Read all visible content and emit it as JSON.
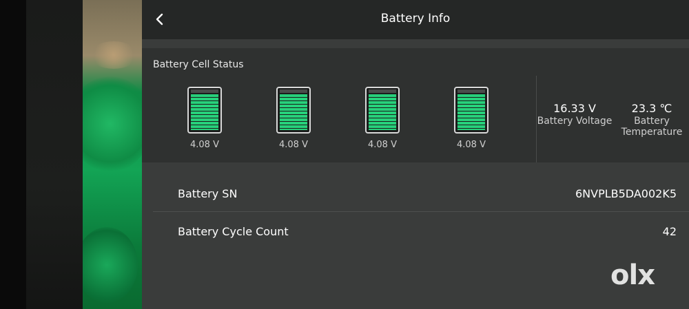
{
  "header": {
    "title": "Battery Info",
    "back_icon": "chevron-left-icon"
  },
  "cell_status": {
    "title": "Battery Cell Status",
    "cells": [
      {
        "voltage": "4.08 V",
        "charge_fraction": 1.0
      },
      {
        "voltage": "4.08 V",
        "charge_fraction": 1.0
      },
      {
        "voltage": "4.08 V",
        "charge_fraction": 1.0
      },
      {
        "voltage": "4.08 V",
        "charge_fraction": 1.0
      }
    ],
    "voltage": {
      "value": "16.33 V",
      "label": "Battery Voltage"
    },
    "temperature": {
      "value": "23.3 ℃",
      "label_line1": "Battery",
      "label_line2": "Temperature"
    }
  },
  "rows": [
    {
      "label": "Battery SN",
      "value": "6NVPLB5DA002K5"
    },
    {
      "label": "Battery Cycle Count",
      "value": "42"
    }
  ],
  "watermark": {
    "text": "OLX"
  },
  "colors": {
    "cell_green": "#27d17b",
    "background": "#3a3c3b",
    "header": "#252726"
  }
}
